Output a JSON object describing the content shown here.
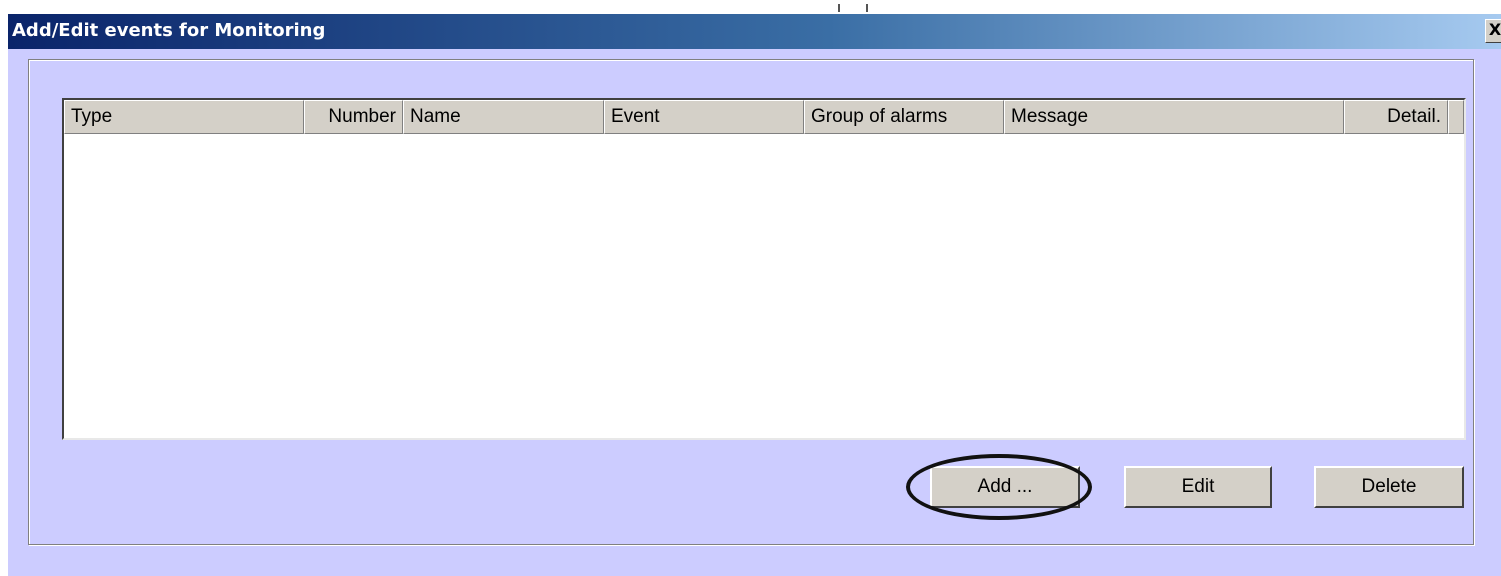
{
  "window": {
    "title": "Add/Edit events for Monitoring",
    "close_label": "X"
  },
  "table": {
    "columns": [
      {
        "label": "Type",
        "align": "left"
      },
      {
        "label": "Number",
        "align": "right"
      },
      {
        "label": "Name",
        "align": "left"
      },
      {
        "label": "Event",
        "align": "left"
      },
      {
        "label": "Group of alarms",
        "align": "left"
      },
      {
        "label": "Message",
        "align": "left"
      },
      {
        "label": "Detail.",
        "align": "right"
      }
    ],
    "rows": []
  },
  "buttons": {
    "add": "Add ...",
    "edit": "Edit",
    "delete": "Delete"
  },
  "colors": {
    "dialog_background": "#ccccff",
    "title_gradient_start": "#0a246a",
    "title_gradient_end": "#a6caf0",
    "button_face": "#d4d0c8",
    "highlight_ellipse": "#111111"
  }
}
